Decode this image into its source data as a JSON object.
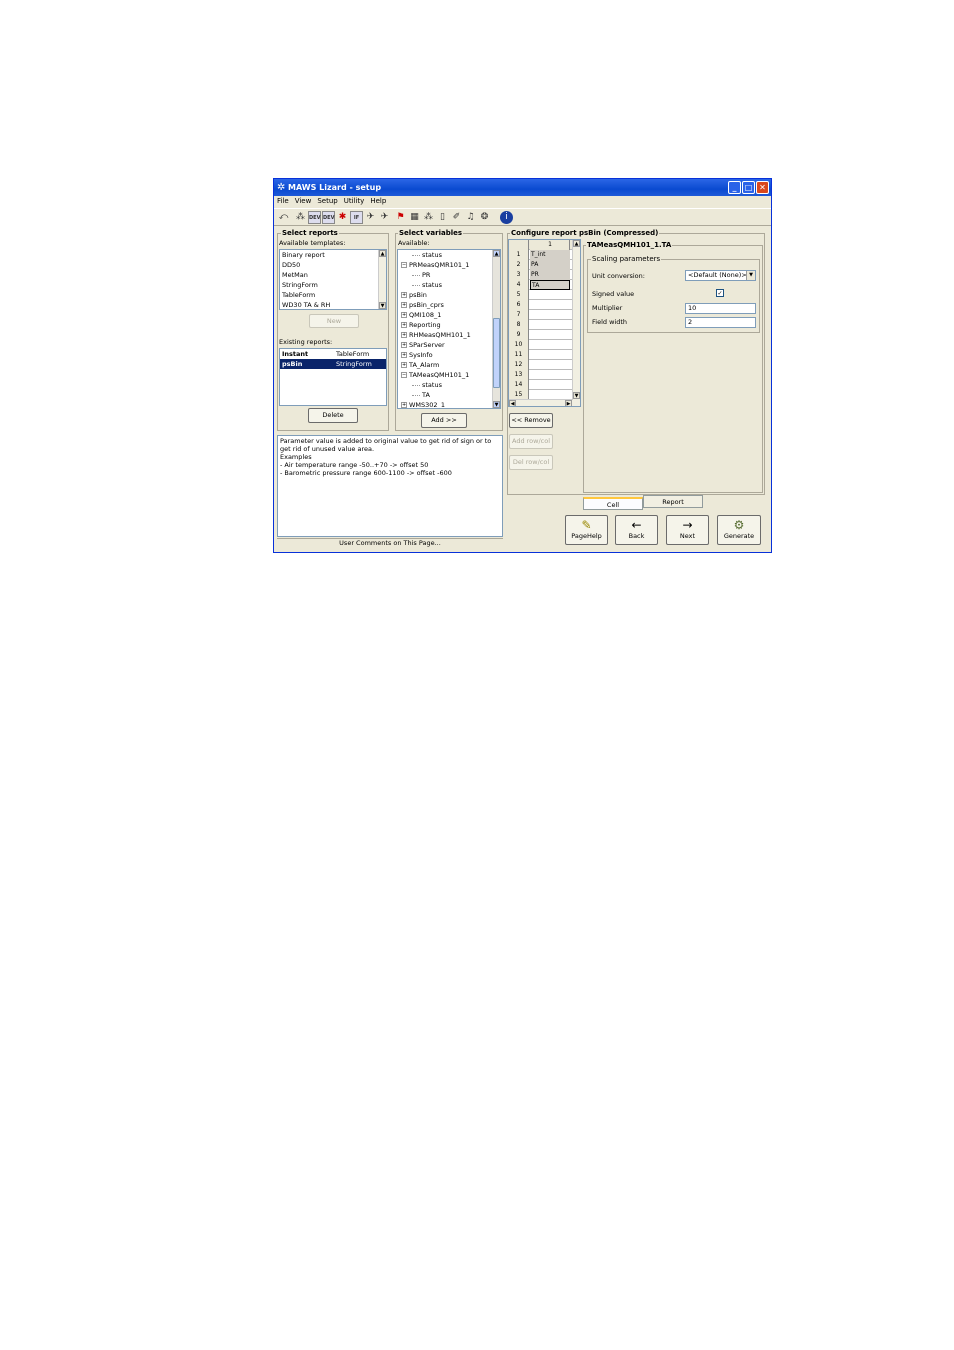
{
  "window": {
    "title": "MAWS Lizard - setup",
    "controls": {
      "minimize": "_",
      "maximize": "□",
      "close": "✕"
    }
  },
  "menu": [
    "File",
    "View",
    "Setup",
    "Utility",
    "Help"
  ],
  "toolbar": {
    "icons": [
      "exit-icon",
      "network-icon",
      "dev-icon",
      "dev-icon",
      "flag-icon",
      "if-icon",
      "run-icon",
      "run-icon",
      "flag-icon",
      "grid-icon",
      "tree-icon",
      "doc-icon",
      "wand-icon",
      "bell-icon",
      "gear-icon",
      "info-icon"
    ],
    "dev_label": "DEV",
    "if_label": "IF"
  },
  "select_reports": {
    "title": "Select reports",
    "templates_label": "Available templates:",
    "templates": [
      "Binary report",
      "DD50",
      "MetMan",
      "StringForm",
      "TableForm",
      "WD30 TA & RH"
    ],
    "new_button": "New",
    "existing_label": "Existing reports:",
    "existing": [
      {
        "name": "Instant",
        "type": "TableForm",
        "selected": false
      },
      {
        "name": "psBin",
        "type": "StringForm",
        "selected": true
      }
    ],
    "delete_button": "Delete"
  },
  "select_variables": {
    "title": "Select variables",
    "available_label": "Available:",
    "tree": [
      {
        "label": "status",
        "level": 2,
        "expander": ""
      },
      {
        "label": "PRMeasQMR101_1",
        "level": 1,
        "expander": "−"
      },
      {
        "label": "PR",
        "level": 2,
        "expander": ""
      },
      {
        "label": "status",
        "level": 2,
        "expander": ""
      },
      {
        "label": "psBin",
        "level": 1,
        "expander": "+"
      },
      {
        "label": "psBin_cprs",
        "level": 1,
        "expander": "+"
      },
      {
        "label": "QMI108_1",
        "level": 1,
        "expander": "+"
      },
      {
        "label": "Reporting",
        "level": 1,
        "expander": "+"
      },
      {
        "label": "RHMeasQMH101_1",
        "level": 1,
        "expander": "+"
      },
      {
        "label": "SParServer",
        "level": 1,
        "expander": "+"
      },
      {
        "label": "SysInfo",
        "level": 1,
        "expander": "+"
      },
      {
        "label": "TA_Alarm",
        "level": 1,
        "expander": "+"
      },
      {
        "label": "TAMeasQMH101_1",
        "level": 1,
        "expander": "−"
      },
      {
        "label": "status",
        "level": 2,
        "expander": ""
      },
      {
        "label": "TA",
        "level": 2,
        "expander": ""
      },
      {
        "label": "WMS302_1",
        "level": 1,
        "expander": "+"
      }
    ],
    "add_button": "Add >>"
  },
  "configure": {
    "title": "Configure report psBin (Compressed)",
    "column_header": "1",
    "rows": [
      {
        "n": "1",
        "v": "T_int"
      },
      {
        "n": "2",
        "v": "PA"
      },
      {
        "n": "3",
        "v": "PR"
      },
      {
        "n": "4",
        "v": "TA"
      },
      {
        "n": "5",
        "v": ""
      },
      {
        "n": "6",
        "v": ""
      },
      {
        "n": "7",
        "v": ""
      },
      {
        "n": "8",
        "v": ""
      },
      {
        "n": "9",
        "v": ""
      },
      {
        "n": "10",
        "v": ""
      },
      {
        "n": "11",
        "v": ""
      },
      {
        "n": "12",
        "v": ""
      },
      {
        "n": "13",
        "v": ""
      },
      {
        "n": "14",
        "v": ""
      },
      {
        "n": "15",
        "v": ""
      }
    ],
    "remove_button": "<< Remove",
    "add_rowcol_button": "Add row/col",
    "del_rowcol_button": "Del row/col"
  },
  "details": {
    "title": "TAMeasQMH101_1.TA",
    "scaling_title": "Scaling parameters",
    "unit_conversion_label": "Unit conversion:",
    "unit_conversion_value": "<Default (None)>",
    "signed_value_label": "Signed value",
    "signed_value_check": "✓",
    "multiplier_label": "Multiplier",
    "multiplier_value": "10",
    "field_width_label": "Field width",
    "field_width_value": "2",
    "tabs": [
      "Cell",
      "Report"
    ]
  },
  "comments": {
    "text": "Parameter value is added to original value to get rid of sign or to get rid of unused value area.\nExamples\n- Air temperature range -50..+70 -> offset 50\n- Barometric pressure range 600-1100 -> offset -600",
    "footer": "User Comments on This Page..."
  },
  "nav": [
    {
      "label": "PageHelp",
      "icon": "help-icon",
      "glyph": "✎"
    },
    {
      "label": "Back",
      "icon": "arrow-left-icon",
      "glyph": "←"
    },
    {
      "label": "Next",
      "icon": "arrow-right-icon",
      "glyph": "→"
    },
    {
      "label": "Generate",
      "icon": "gears-icon",
      "glyph": "⚙"
    }
  ]
}
